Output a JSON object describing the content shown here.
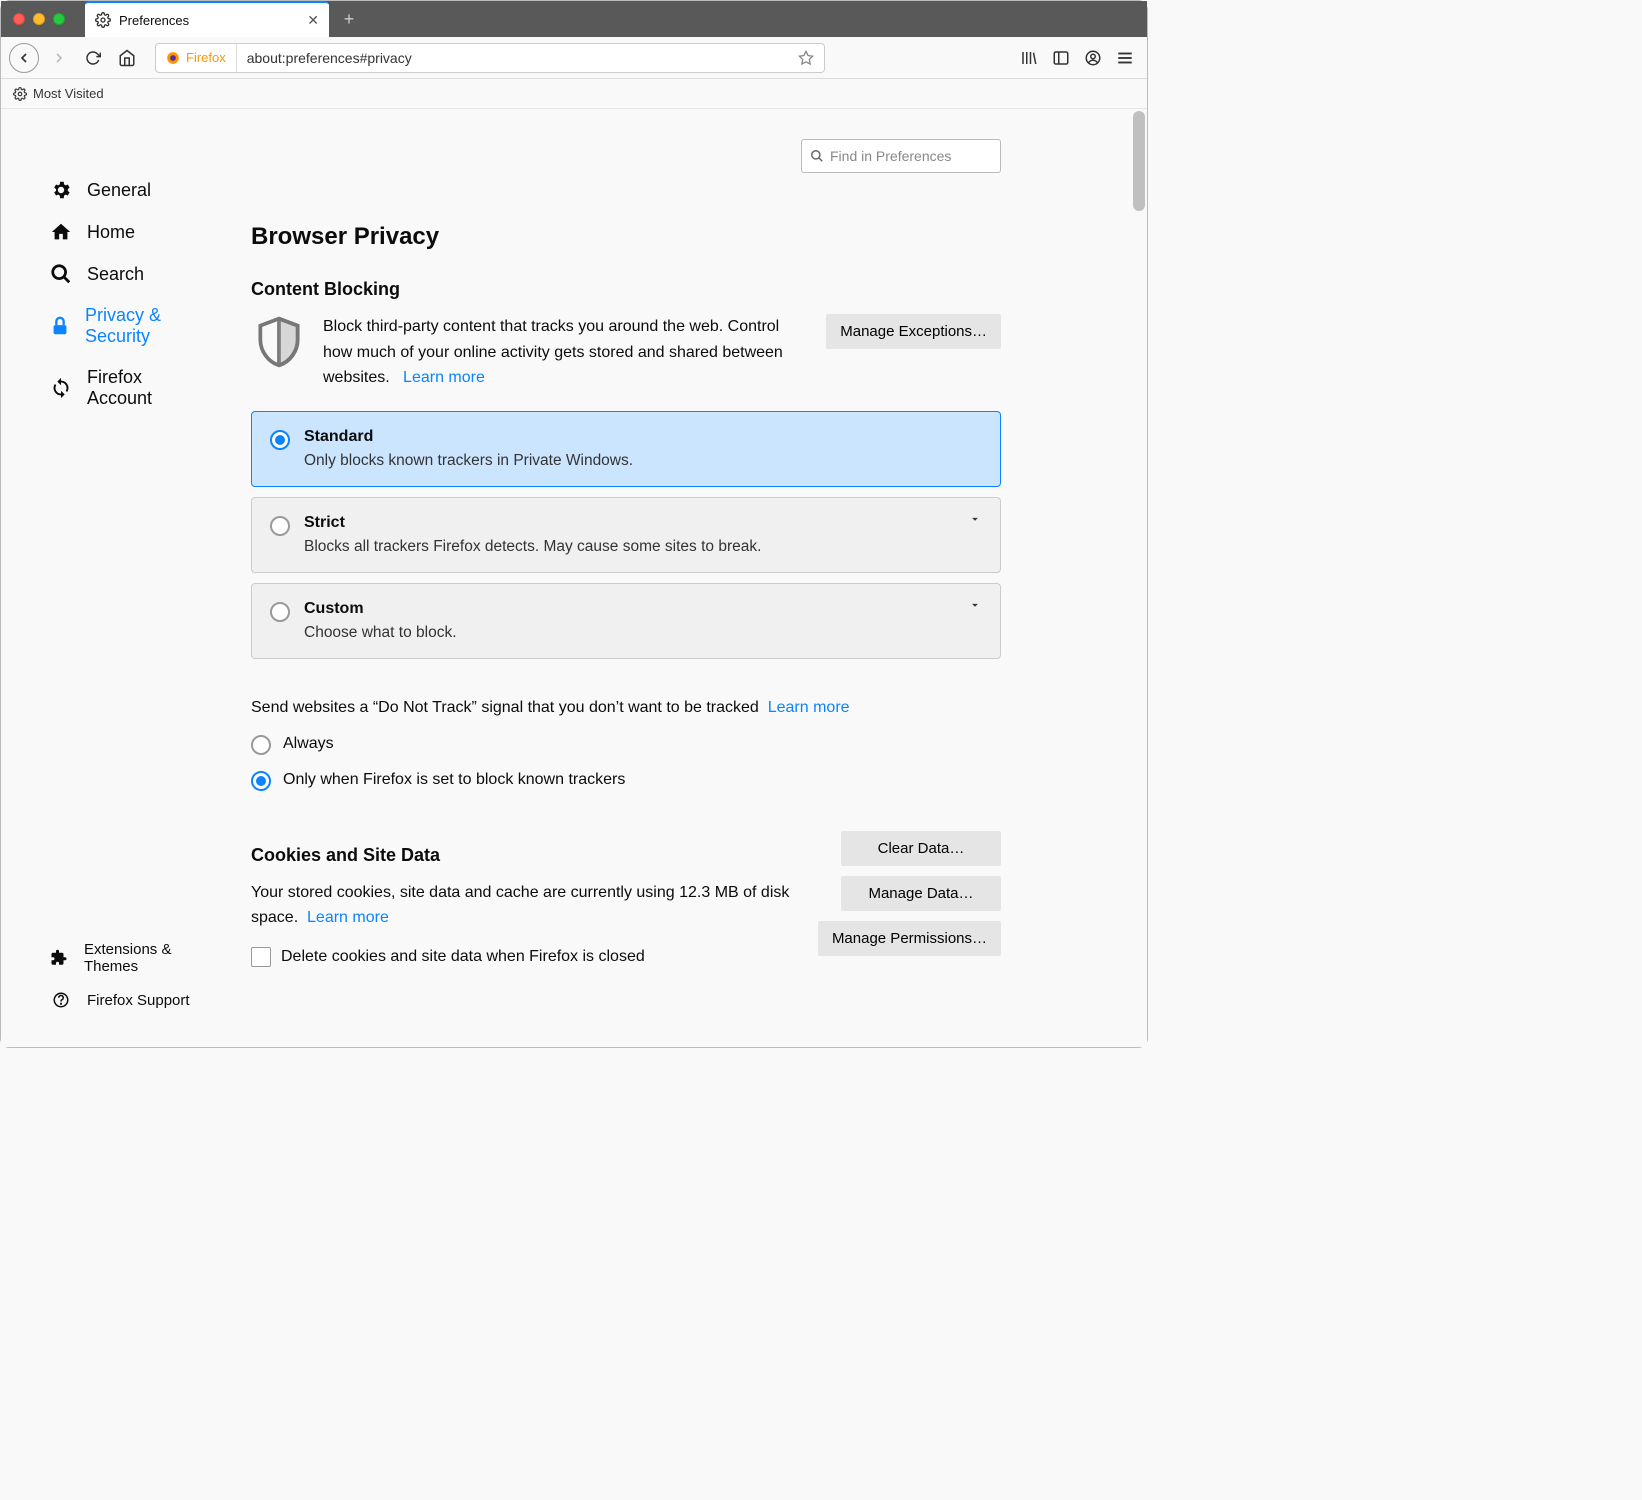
{
  "window": {
    "tab_title": "Preferences"
  },
  "urlbar": {
    "identity": "Firefox",
    "url": "about:preferences#privacy"
  },
  "bookmarks": {
    "most_visited": "Most Visited"
  },
  "search": {
    "placeholder": "Find in Preferences"
  },
  "sidebar": {
    "items": [
      {
        "label": "General"
      },
      {
        "label": "Home"
      },
      {
        "label": "Search"
      },
      {
        "label": "Privacy & Security"
      },
      {
        "label": "Firefox Account"
      }
    ],
    "bottom": [
      {
        "label": "Extensions & Themes"
      },
      {
        "label": "Firefox Support"
      }
    ]
  },
  "page": {
    "title": "Browser Privacy",
    "content_blocking": {
      "heading": "Content Blocking",
      "desc": "Block third-party content that tracks you around the web. Control how much of your online activity gets stored and shared between websites.",
      "learn_more": "Learn more",
      "manage_exceptions": "Manage Exceptions…",
      "options": [
        {
          "title": "Standard",
          "desc": "Only blocks known trackers in Private Windows."
        },
        {
          "title": "Strict",
          "desc": "Blocks all trackers Firefox detects. May cause some sites to break."
        },
        {
          "title": "Custom",
          "desc": "Choose what to block."
        }
      ]
    },
    "dnt": {
      "text": "Send websites a “Do Not Track” signal that you don’t want to be tracked",
      "learn_more": "Learn more",
      "always": "Always",
      "only_when": "Only when Firefox is set to block known trackers"
    },
    "cookies": {
      "heading": "Cookies and Site Data",
      "desc_prefix": "Your stored cookies, site data and cache are currently using 12.3 MB of disk space.",
      "learn_more": "Learn more",
      "delete_on_close": "Delete cookies and site data when Firefox is closed",
      "clear_data": "Clear Data…",
      "manage_data": "Manage Data…",
      "manage_permissions": "Manage Permissions…"
    }
  }
}
